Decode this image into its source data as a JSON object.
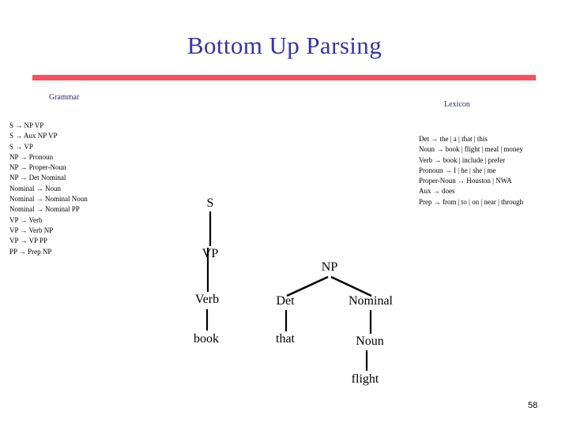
{
  "slide": {
    "title": "Bottom Up Parsing",
    "page_number": "58",
    "title_color": "#3333a8",
    "rule_color": "#f4525c",
    "label_color": "#2b2b6b"
  },
  "grammar": {
    "label": "Grammar",
    "rules": [
      "S → NP VP",
      "S → Aux NP VP",
      "S → VP",
      "NP → Pronoun",
      "NP → Proper-Noun",
      "NP → Det Nominal",
      "Nominal → Noun",
      "Nominal → Nominal Noun",
      "Nominal → Nominal PP",
      "VP → Verb",
      "VP → Verb NP",
      "VP → VP PP",
      "PP → Prep NP"
    ]
  },
  "lexicon": {
    "label": "Lexicon",
    "rules": [
      "Det → the | a | that | this",
      "Noun → book | flight | meal | money",
      "Verb → book | include | prefer",
      "Pronoun → I | he | she | me",
      "Proper-Noun → Houston | NWA",
      "Aux → does",
      "Prep → from | to | on | near | through"
    ]
  },
  "parse_tree": {
    "nodes": {
      "s": "S",
      "vp": "VP",
      "verb": "Verb",
      "book": "book",
      "np": "NP",
      "det": "Det",
      "nominal": "Nominal",
      "that": "that",
      "noun": "Noun",
      "flight": "flight"
    }
  }
}
